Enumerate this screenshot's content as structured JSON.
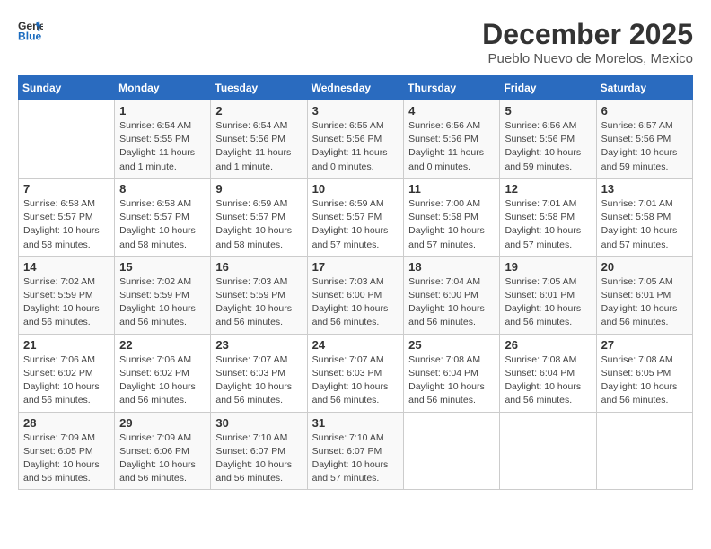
{
  "logo": {
    "line1": "General",
    "line2": "Blue"
  },
  "title": "December 2025",
  "subtitle": "Pueblo Nuevo de Morelos, Mexico",
  "header_days": [
    "Sunday",
    "Monday",
    "Tuesday",
    "Wednesday",
    "Thursday",
    "Friday",
    "Saturday"
  ],
  "weeks": [
    [
      {
        "num": "",
        "info": ""
      },
      {
        "num": "1",
        "info": "Sunrise: 6:54 AM\nSunset: 5:55 PM\nDaylight: 11 hours\nand 1 minute."
      },
      {
        "num": "2",
        "info": "Sunrise: 6:54 AM\nSunset: 5:56 PM\nDaylight: 11 hours\nand 1 minute."
      },
      {
        "num": "3",
        "info": "Sunrise: 6:55 AM\nSunset: 5:56 PM\nDaylight: 11 hours\nand 0 minutes."
      },
      {
        "num": "4",
        "info": "Sunrise: 6:56 AM\nSunset: 5:56 PM\nDaylight: 11 hours\nand 0 minutes."
      },
      {
        "num": "5",
        "info": "Sunrise: 6:56 AM\nSunset: 5:56 PM\nDaylight: 10 hours\nand 59 minutes."
      },
      {
        "num": "6",
        "info": "Sunrise: 6:57 AM\nSunset: 5:56 PM\nDaylight: 10 hours\nand 59 minutes."
      }
    ],
    [
      {
        "num": "7",
        "info": "Sunrise: 6:58 AM\nSunset: 5:57 PM\nDaylight: 10 hours\nand 58 minutes."
      },
      {
        "num": "8",
        "info": "Sunrise: 6:58 AM\nSunset: 5:57 PM\nDaylight: 10 hours\nand 58 minutes."
      },
      {
        "num": "9",
        "info": "Sunrise: 6:59 AM\nSunset: 5:57 PM\nDaylight: 10 hours\nand 58 minutes."
      },
      {
        "num": "10",
        "info": "Sunrise: 6:59 AM\nSunset: 5:57 PM\nDaylight: 10 hours\nand 57 minutes."
      },
      {
        "num": "11",
        "info": "Sunrise: 7:00 AM\nSunset: 5:58 PM\nDaylight: 10 hours\nand 57 minutes."
      },
      {
        "num": "12",
        "info": "Sunrise: 7:01 AM\nSunset: 5:58 PM\nDaylight: 10 hours\nand 57 minutes."
      },
      {
        "num": "13",
        "info": "Sunrise: 7:01 AM\nSunset: 5:58 PM\nDaylight: 10 hours\nand 57 minutes."
      }
    ],
    [
      {
        "num": "14",
        "info": "Sunrise: 7:02 AM\nSunset: 5:59 PM\nDaylight: 10 hours\nand 56 minutes."
      },
      {
        "num": "15",
        "info": "Sunrise: 7:02 AM\nSunset: 5:59 PM\nDaylight: 10 hours\nand 56 minutes."
      },
      {
        "num": "16",
        "info": "Sunrise: 7:03 AM\nSunset: 5:59 PM\nDaylight: 10 hours\nand 56 minutes."
      },
      {
        "num": "17",
        "info": "Sunrise: 7:03 AM\nSunset: 6:00 PM\nDaylight: 10 hours\nand 56 minutes."
      },
      {
        "num": "18",
        "info": "Sunrise: 7:04 AM\nSunset: 6:00 PM\nDaylight: 10 hours\nand 56 minutes."
      },
      {
        "num": "19",
        "info": "Sunrise: 7:05 AM\nSunset: 6:01 PM\nDaylight: 10 hours\nand 56 minutes."
      },
      {
        "num": "20",
        "info": "Sunrise: 7:05 AM\nSunset: 6:01 PM\nDaylight: 10 hours\nand 56 minutes."
      }
    ],
    [
      {
        "num": "21",
        "info": "Sunrise: 7:06 AM\nSunset: 6:02 PM\nDaylight: 10 hours\nand 56 minutes."
      },
      {
        "num": "22",
        "info": "Sunrise: 7:06 AM\nSunset: 6:02 PM\nDaylight: 10 hours\nand 56 minutes."
      },
      {
        "num": "23",
        "info": "Sunrise: 7:07 AM\nSunset: 6:03 PM\nDaylight: 10 hours\nand 56 minutes."
      },
      {
        "num": "24",
        "info": "Sunrise: 7:07 AM\nSunset: 6:03 PM\nDaylight: 10 hours\nand 56 minutes."
      },
      {
        "num": "25",
        "info": "Sunrise: 7:08 AM\nSunset: 6:04 PM\nDaylight: 10 hours\nand 56 minutes."
      },
      {
        "num": "26",
        "info": "Sunrise: 7:08 AM\nSunset: 6:04 PM\nDaylight: 10 hours\nand 56 minutes."
      },
      {
        "num": "27",
        "info": "Sunrise: 7:08 AM\nSunset: 6:05 PM\nDaylight: 10 hours\nand 56 minutes."
      }
    ],
    [
      {
        "num": "28",
        "info": "Sunrise: 7:09 AM\nSunset: 6:05 PM\nDaylight: 10 hours\nand 56 minutes."
      },
      {
        "num": "29",
        "info": "Sunrise: 7:09 AM\nSunset: 6:06 PM\nDaylight: 10 hours\nand 56 minutes."
      },
      {
        "num": "30",
        "info": "Sunrise: 7:10 AM\nSunset: 6:07 PM\nDaylight: 10 hours\nand 56 minutes."
      },
      {
        "num": "31",
        "info": "Sunrise: 7:10 AM\nSunset: 6:07 PM\nDaylight: 10 hours\nand 57 minutes."
      },
      {
        "num": "",
        "info": ""
      },
      {
        "num": "",
        "info": ""
      },
      {
        "num": "",
        "info": ""
      }
    ]
  ]
}
